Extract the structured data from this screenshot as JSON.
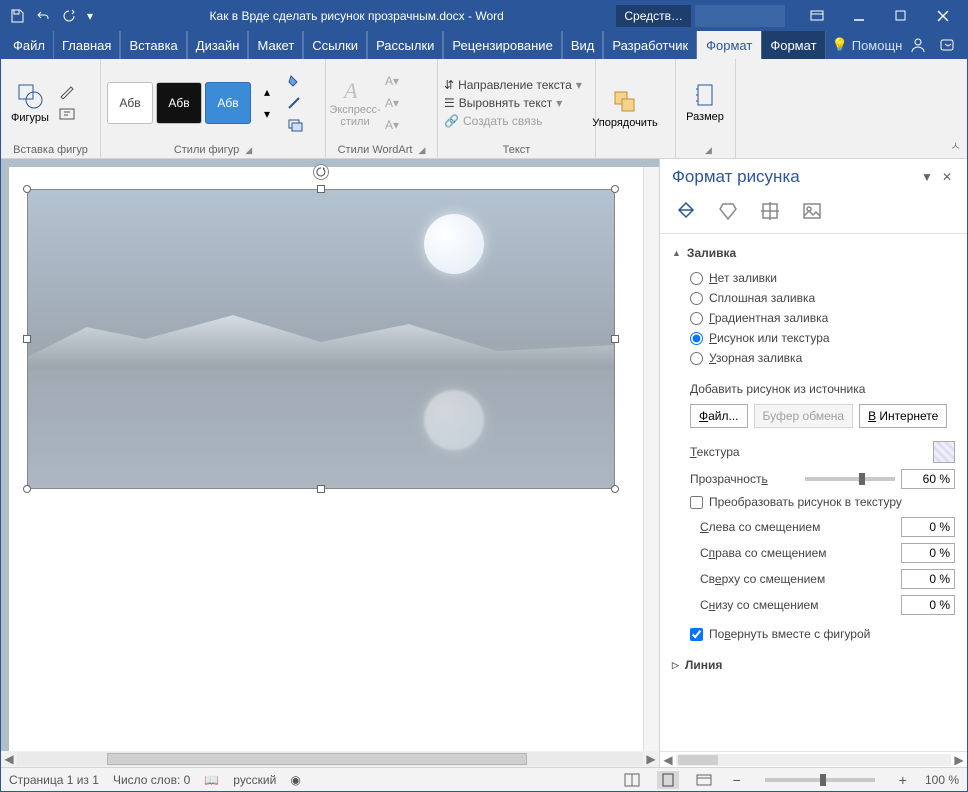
{
  "titlebar": {
    "title": "Как в Врде сделать рисунок прозрачным.docx - Word",
    "tools_label": "Средств…"
  },
  "tabs": {
    "file": "Файл",
    "home": "Главная",
    "insert": "Вставка",
    "design": "Дизайн",
    "layout": "Макет",
    "references": "Ссылки",
    "mailings": "Рассылки",
    "review": "Рецензирование",
    "view": "Вид",
    "developer": "Разработчик",
    "format1": "Формат",
    "format2": "Формат",
    "help": "Помощн"
  },
  "ribbon": {
    "shapes": "Фигуры",
    "insert_shapes": "Вставка фигур",
    "swatch_label": "Абв",
    "shape_styles": "Стили фигур",
    "express_styles": "Экспресс-стили",
    "wordart_styles": "Стили WordArt",
    "text_direction": "Направление текста",
    "align_text": "Выровнять текст",
    "create_link": "Создать связь",
    "text_group": "Текст",
    "arrange": "Упорядочить",
    "size": "Размер"
  },
  "pane": {
    "title": "Формат рисунка",
    "fill_section": "Заливка",
    "no_fill": "Нет заливки",
    "solid_fill": "Сплошная заливка",
    "gradient_fill": "Градиентная заливка",
    "picture_fill": "Рисунок или текстура",
    "pattern_fill": "Узорная заливка",
    "insert_from": "Добавить рисунок из источника",
    "file_btn": "Файл...",
    "clipboard_btn": "Буфер обмена",
    "online_btn": "В Интернете",
    "texture": "Текстура",
    "transparency": "Прозрачность",
    "transparency_value": "60 %",
    "tile_as_texture": "Преобразовать рисунок в текстуру",
    "offset_left": "Слева со смещением",
    "offset_right": "Справа со смещением",
    "offset_top": "Сверху со смещением",
    "offset_bottom": "Снизу со смещением",
    "offset_value": "0 %",
    "rotate_with_shape": "Повернуть вместе с фигурой",
    "line_section": "Линия"
  },
  "statusbar": {
    "page": "Страница 1 из 1",
    "words": "Число слов: 0",
    "lang": "русский",
    "zoom": "100 %"
  }
}
